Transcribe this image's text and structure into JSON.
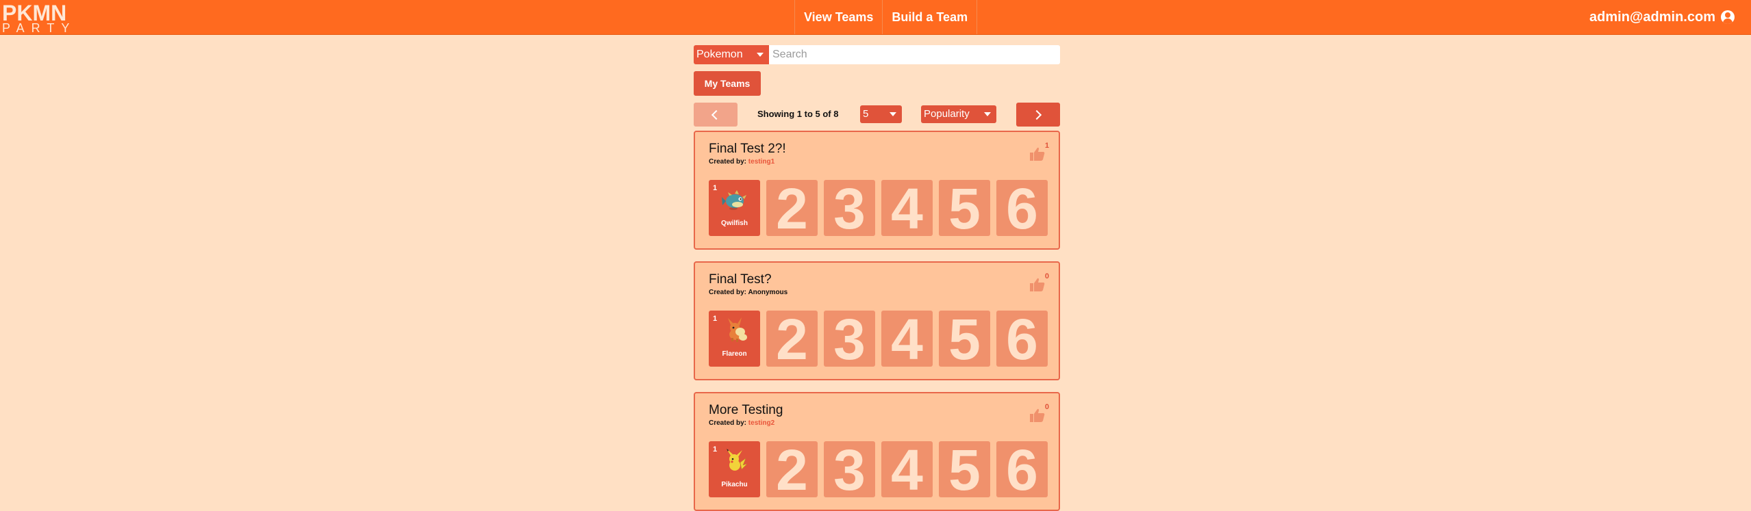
{
  "nav": {
    "logo_top": "PKMN",
    "logo_bottom": "PARTY",
    "links": [
      "View Teams",
      "Build a Team"
    ],
    "user_email": "admin@admin.com"
  },
  "search": {
    "type_value": "Pokemon",
    "placeholder": "Search"
  },
  "my_teams_label": "My Teams",
  "pagination": {
    "info": "Showing 1 to 5 of 8",
    "page_size": "5",
    "sort": "Popularity"
  },
  "teams": [
    {
      "title": "Final Test 2?!",
      "created_by_label": "Created by:",
      "author": "testing1",
      "likes": "1",
      "slot1": {
        "number": "1",
        "pokemon": "Qwilfish"
      },
      "empty_slots": [
        "2",
        "3",
        "4",
        "5",
        "6"
      ]
    },
    {
      "title": "Final Test?",
      "created_by_label": "Created by:",
      "author": "Anonymous",
      "likes": "0",
      "slot1": {
        "number": "1",
        "pokemon": "Flareon"
      },
      "empty_slots": [
        "2",
        "3",
        "4",
        "5",
        "6"
      ]
    },
    {
      "title": "More Testing",
      "created_by_label": "Created by:",
      "author": "testing2",
      "likes": "0",
      "slot1": {
        "number": "1",
        "pokemon": "Pikachu"
      },
      "empty_slots": [
        "2",
        "3",
        "4",
        "5",
        "6"
      ]
    }
  ],
  "colors": {
    "background": "#ffe0c4",
    "navbar": "#ff6a1f",
    "accent": "#e0533a",
    "card": "#ffc49a",
    "empty_slot": "#f0916c"
  }
}
